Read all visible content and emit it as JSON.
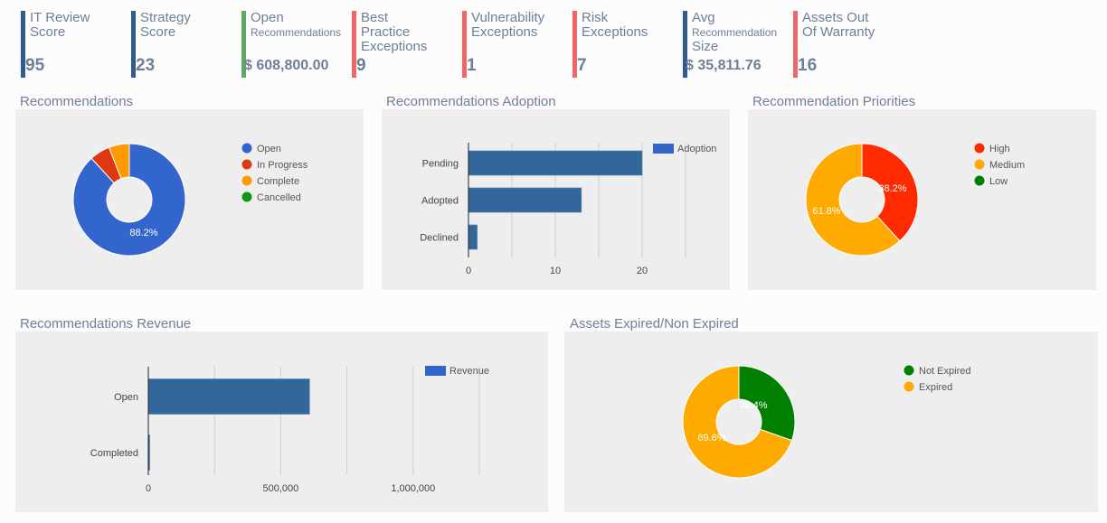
{
  "kpis": [
    {
      "label_lines": [
        "IT Review",
        "Score"
      ],
      "value": "95",
      "color": "blue"
    },
    {
      "label_lines": [
        "Strategy",
        "Score"
      ],
      "value": "23",
      "color": "blue"
    },
    {
      "label_lines": [
        "Open"
      ],
      "label_small": "Recommendations",
      "value": "$ 608,800.00",
      "color": "green"
    },
    {
      "label_lines": [
        "Best",
        "Practice",
        "Exceptions"
      ],
      "value": "9",
      "color": "red"
    },
    {
      "label_lines": [
        "Vulnerability",
        "Exceptions"
      ],
      "value": "1",
      "color": "red"
    },
    {
      "label_lines": [
        "Risk",
        "Exceptions"
      ],
      "value": "7",
      "color": "red"
    },
    {
      "label_lines": [
        "Avg"
      ],
      "label_small": "Recommendation",
      "label_after": "Size",
      "value": "$ 35,811.76",
      "color": "blue"
    },
    {
      "label_lines": [
        "Assets Out",
        "Of Warranty"
      ],
      "value": "16",
      "color": "red"
    }
  ],
  "chart_data": [
    {
      "id": "recommendations",
      "type": "pie",
      "donut": true,
      "title": "Recommendations",
      "labels": [
        "Open",
        "In Progress",
        "Complete",
        "Cancelled"
      ],
      "values": [
        88.2,
        5.9,
        5.9,
        0
      ],
      "colors": [
        "#3366cc",
        "#dc3912",
        "#ff9900",
        "#109618"
      ],
      "slice_labels": [
        "88.2%",
        "",
        "",
        ""
      ],
      "legend": "right"
    },
    {
      "id": "adoption",
      "type": "bar",
      "orientation": "horizontal",
      "title": "Recommendations Adoption",
      "categories": [
        "Pending",
        "Adopted",
        "Declined"
      ],
      "series": [
        {
          "name": "Adoption",
          "values": [
            20,
            13,
            1
          ]
        }
      ],
      "xlim": [
        0,
        25
      ],
      "xticks": [
        0,
        10,
        20
      ],
      "grid": true,
      "bar_color": "#336699",
      "legend_color": "#3366cc",
      "legend": "right"
    },
    {
      "id": "priorities",
      "type": "pie",
      "donut": true,
      "title": "Recommendation Priorities",
      "labels": [
        "High",
        "Medium",
        "Low"
      ],
      "values": [
        38.2,
        61.8,
        0
      ],
      "colors": [
        "#ff2a00",
        "#ffaa00",
        "#007f00"
      ],
      "slice_labels": [
        "38.2%",
        "61.8%",
        ""
      ],
      "legend": "right"
    },
    {
      "id": "revenue",
      "type": "bar",
      "orientation": "horizontal",
      "title": "Recommendations Revenue",
      "categories": [
        "Open",
        "Completed"
      ],
      "series": [
        {
          "name": "Revenue",
          "values": [
            608800,
            5000
          ]
        }
      ],
      "xlim": [
        0,
        1250000
      ],
      "xticks": [
        0,
        500000,
        1000000
      ],
      "xtick_labels": [
        "0",
        "500,000",
        "1,000,000"
      ],
      "grid": true,
      "bar_color": "#336699",
      "legend_color": "#3366cc",
      "legend": "right"
    },
    {
      "id": "assets",
      "type": "pie",
      "donut": true,
      "title": "Assets Expired/Non Expired",
      "labels": [
        "Not Expired",
        "Expired"
      ],
      "values": [
        30.4,
        69.6
      ],
      "colors": [
        "#007f00",
        "#ffaa00"
      ],
      "slice_labels": [
        "30.4%",
        "69.6%"
      ],
      "legend": "right"
    }
  ]
}
